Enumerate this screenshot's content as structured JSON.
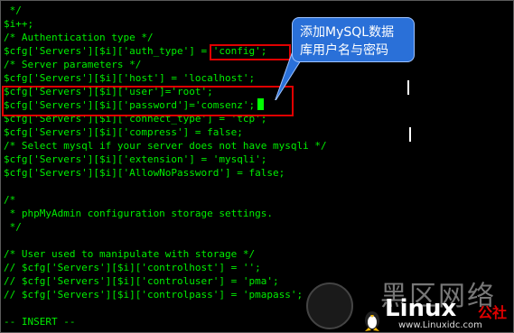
{
  "editor": {
    "lines": [
      " */",
      "$i++;",
      "/* Authentication type */",
      "$cfg['Servers'][$i]['auth_type'] = 'config';",
      "/* Server parameters */",
      "$cfg['Servers'][$i]['host'] = 'localhost';",
      "$cfg['Servers'][$i]['user']='root';",
      "$cfg['Servers'][$i]['password']='comsenz';",
      "$cfg['Servers'][$i]['connect_type'] = 'tcp';",
      "$cfg['Servers'][$i]['compress'] = false;",
      "/* Select mysql if your server does not have mysqli */",
      "$cfg['Servers'][$i]['extension'] = 'mysqli';",
      "$cfg['Servers'][$i]['AllowNoPassword'] = false;",
      "",
      "/*",
      " * phpMyAdmin configuration storage settings.",
      " */",
      "",
      "/* User used to manipulate with storage */",
      "// $cfg['Servers'][$i]['controlhost'] = '';",
      "// $cfg['Servers'][$i]['controluser'] = 'pma';",
      "// $cfg['Servers'][$i]['controlpass'] = 'pmapass';",
      "",
      "-- INSERT --"
    ],
    "mode": "-- INSERT --"
  },
  "callout": {
    "text_line1": "添加MySQL数据",
    "text_line2": "库用户名与密码"
  },
  "watermark": {
    "brand_big": "黑区网络",
    "brand_linux": "Linux",
    "brand_suffix": "公社",
    "url": "www.Linuxidc.com"
  },
  "colors": {
    "text": "#00ee00",
    "highlight": "#e00000",
    "callout": "#2a70d8"
  }
}
